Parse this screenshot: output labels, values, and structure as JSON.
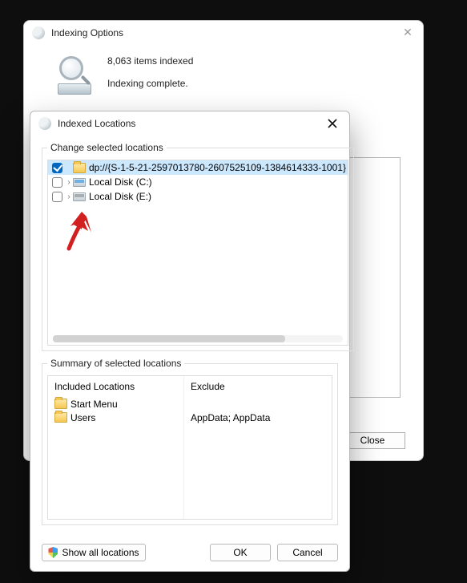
{
  "parent": {
    "title": "Indexing Options",
    "items_indexed": "8,063 items indexed",
    "status": "Indexing complete.",
    "close_label": "Close"
  },
  "dialog": {
    "title": "Indexed Locations",
    "change_legend": "Change selected locations",
    "tree": [
      {
        "checked": true,
        "expandable": false,
        "icon": "folder",
        "label": "dp://{S-1-5-21-2597013780-2607525109-1384614333-1001}",
        "selected": true
      },
      {
        "checked": false,
        "expandable": true,
        "icon": "drive-c",
        "label": "Local Disk (C:)",
        "selected": false
      },
      {
        "checked": false,
        "expandable": true,
        "icon": "drive-e",
        "label": "Local Disk (E:)",
        "selected": false
      }
    ],
    "summary_legend": "Summary of selected locations",
    "summary": {
      "included_header": "Included Locations",
      "exclude_header": "Exclude",
      "included": [
        "Start Menu",
        "Users"
      ],
      "exclude": [
        "",
        "AppData; AppData"
      ]
    },
    "show_all_label": "Show all locations",
    "ok_label": "OK",
    "cancel_label": "Cancel"
  }
}
